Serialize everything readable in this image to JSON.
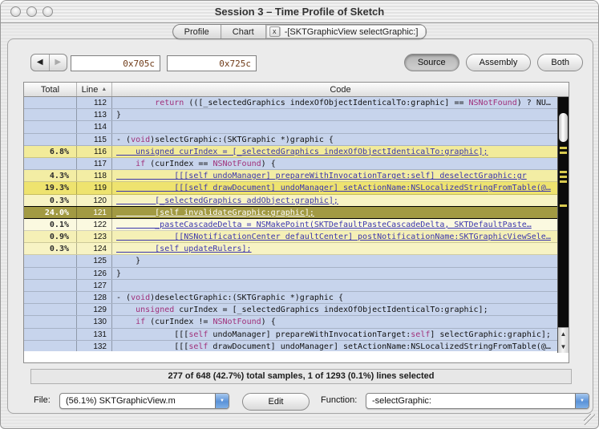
{
  "window": {
    "title": "Session 3 – Time Profile of Sketch"
  },
  "tabs": [
    {
      "label": "Profile",
      "active": false
    },
    {
      "label": "Chart",
      "active": false
    },
    {
      "label": "-[SKTGraphicView selectGraphic:]",
      "active": true,
      "closable": true,
      "close_glyph": "x"
    }
  ],
  "toolbar": {
    "back_glyph": "◀",
    "forward_glyph": "▶",
    "address_start": "0x705c",
    "address_end": "0x725c",
    "view_buttons": [
      {
        "label": "Source",
        "active": true
      },
      {
        "label": "Assembly",
        "active": false
      },
      {
        "label": "Both",
        "active": false
      }
    ]
  },
  "table": {
    "columns": [
      "Total",
      "Line",
      "Code"
    ],
    "sort_glyph": "▲",
    "rows": [
      {
        "total": "",
        "line": "112",
        "code": "        return (([_selectedGraphics indexOfObjectIdenticalTo:graphic] == NSNotFound) ? NU…",
        "link": false
      },
      {
        "total": "",
        "line": "113",
        "code": "}",
        "link": false
      },
      {
        "total": "",
        "line": "114",
        "code": "",
        "link": false
      },
      {
        "total": "",
        "line": "115",
        "code": "- (void)selectGraphic:(SKTGraphic *)graphic {",
        "link": false
      },
      {
        "total": "6.8%",
        "line": "116",
        "code": "    unsigned curIndex = [_selectedGraphics indexOfObjectIdenticalTo:graphic];",
        "link": true,
        "bg": "#f2eb9a"
      },
      {
        "total": "",
        "line": "117",
        "code": "    if (curIndex == NSNotFound) {",
        "link": false
      },
      {
        "total": "4.3%",
        "line": "118",
        "code": "            [[[self undoManager] prepareWithInvocationTarget:self] deselectGraphic:gr",
        "link": true,
        "bg": "#f3eda4"
      },
      {
        "total": "19.3%",
        "line": "119",
        "code": "            [[[self drawDocument] undoManager] setActionName:NSLocalizedStringFromTable(@…",
        "link": true,
        "bg": "#eee36f"
      },
      {
        "total": "0.3%",
        "line": "120",
        "code": "        [_selectedGraphics addObject:graphic];",
        "link": true,
        "bg": "#f7f3c4"
      },
      {
        "total": "24.0%",
        "line": "121",
        "code": "        [self invalidateGraphic:graphic];",
        "link": true,
        "selected": true
      },
      {
        "total": "0.1%",
        "line": "122",
        "code": "        _pasteCascadeDelta = NSMakePoint(SKTDefaultPasteCascadeDelta, SKTDefaultPaste…",
        "link": true,
        "bg": "#fbf9e0"
      },
      {
        "total": "0.9%",
        "line": "123",
        "code": "            [[NSNotificationCenter defaultCenter] postNotificationName:SKTGraphicViewSele…",
        "link": true,
        "bg": "#f5f0b6"
      },
      {
        "total": "0.3%",
        "line": "124",
        "code": "        [self updateRulers];",
        "link": true,
        "bg": "#f7f3c4"
      },
      {
        "total": "",
        "line": "125",
        "code": "    }",
        "link": false
      },
      {
        "total": "",
        "line": "126",
        "code": "}",
        "link": false
      },
      {
        "total": "",
        "line": "127",
        "code": "",
        "link": false
      },
      {
        "total": "",
        "line": "128",
        "code": "- (void)deselectGraphic:(SKTGraphic *)graphic {",
        "link": false
      },
      {
        "total": "",
        "line": "129",
        "code": "    unsigned curIndex = [_selectedGraphics indexOfObjectIdenticalTo:graphic];",
        "link": false
      },
      {
        "total": "",
        "line": "130",
        "code": "    if (curIndex != NSNotFound) {",
        "link": false
      },
      {
        "total": "",
        "line": "131",
        "code": "            [[[self undoManager] prepareWithInvocationTarget:self] selectGraphic:graphic];",
        "link": false
      },
      {
        "total": "",
        "line": "132",
        "code": "            [[[self drawDocument] undoManager] setActionName:NSLocalizedStringFromTable(@…",
        "link": false
      }
    ]
  },
  "scrollbar": {
    "up_glyph": "▲",
    "down_glyph": "▼",
    "mark_offsets": [
      62,
      68,
      92,
      98,
      104,
      134
    ]
  },
  "status": "277 of 648 (42.7%) total samples, 1 of 1293 (0.1%) lines selected",
  "footer": {
    "file_label": "File:",
    "file_value": "(56.1%) SKTGraphicView.m",
    "edit_label": "Edit",
    "function_label": "Function:",
    "function_value": "-selectGraphic:",
    "popup_arrow_glyph": "▼"
  },
  "colors": {
    "row_blue": "#c7d4ec",
    "selected_row_bg": "#a29a43",
    "link_text": "#3a35ad",
    "keyword_text": "#a0307a",
    "mark_yellow": "#d8c94e"
  }
}
